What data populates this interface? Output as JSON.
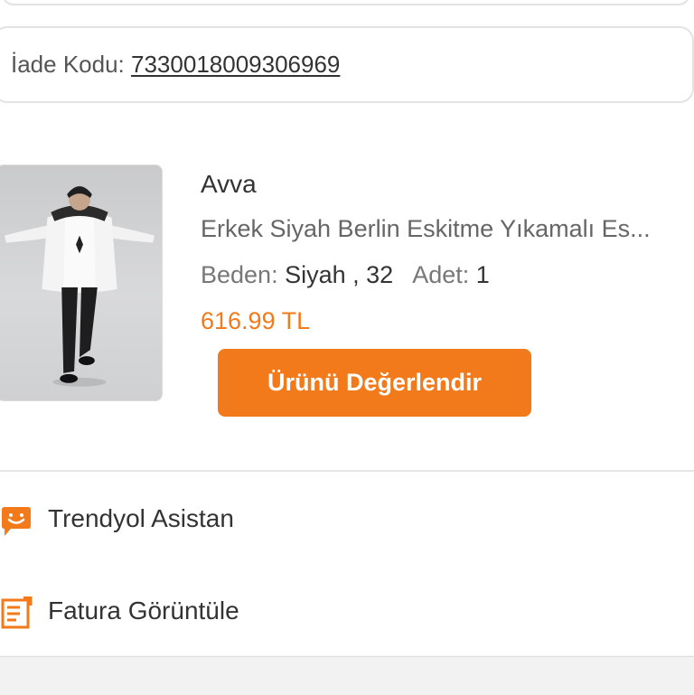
{
  "return_section": {
    "label": "İade Kodu:",
    "code": "7330018009306969"
  },
  "product": {
    "brand": "Avva",
    "name": "Erkek Siyah Berlin Eskitme Yıkamalı Es...",
    "size_label": "Beden:",
    "size_value": "Siyah , 32",
    "qty_label": "Adet:",
    "qty_value": "1",
    "price": "616.99 TL",
    "rate_button": "Ürünü Değerlendir"
  },
  "actions": [
    {
      "label": "Trendyol Asistan",
      "icon": "assistant-chat-icon"
    },
    {
      "label": "Fatura Görüntüle",
      "icon": "invoice-icon"
    }
  ],
  "colors": {
    "accent": "#f27a1a",
    "text_primary": "#333333",
    "text_secondary": "#666666",
    "border": "#e3e3e3"
  }
}
